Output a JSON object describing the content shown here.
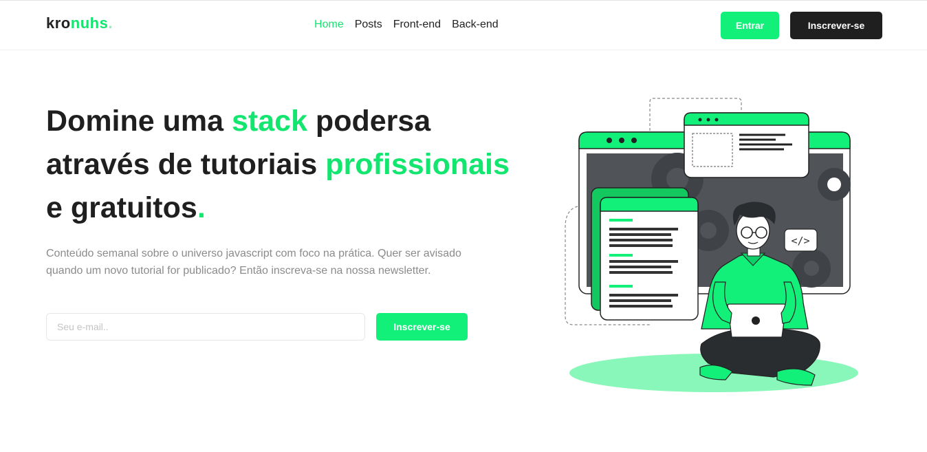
{
  "header": {
    "logo": {
      "part1": "kro",
      "part2": "nuhs",
      "part3": "."
    },
    "nav": [
      {
        "label": "Home",
        "active": true
      },
      {
        "label": "Posts",
        "active": false
      },
      {
        "label": "Front-end",
        "active": false
      },
      {
        "label": "Back-end",
        "active": false
      }
    ],
    "login_label": "Entrar",
    "signup_label": "Inscrever-se"
  },
  "hero": {
    "title": {
      "t1": "Domine uma ",
      "t2": "stack",
      "t3": " podersa através de tutoriais ",
      "t4": "profissionais",
      "t5": " e gratuitos",
      "t6": "."
    },
    "description": "Conteúdo semanal sobre o universo javascript com foco na prática. Quer ser avisado quando um novo tutorial for publicado? Então inscreva-se na nossa newsletter.",
    "email_placeholder": "Seu e-mail..",
    "email_value": "",
    "submit_label": "Inscrever-se",
    "code_tag": "</>"
  },
  "colors": {
    "accent": "#12e66f",
    "dark": "#1f1f1f",
    "text_muted": "#8b8b8b"
  }
}
